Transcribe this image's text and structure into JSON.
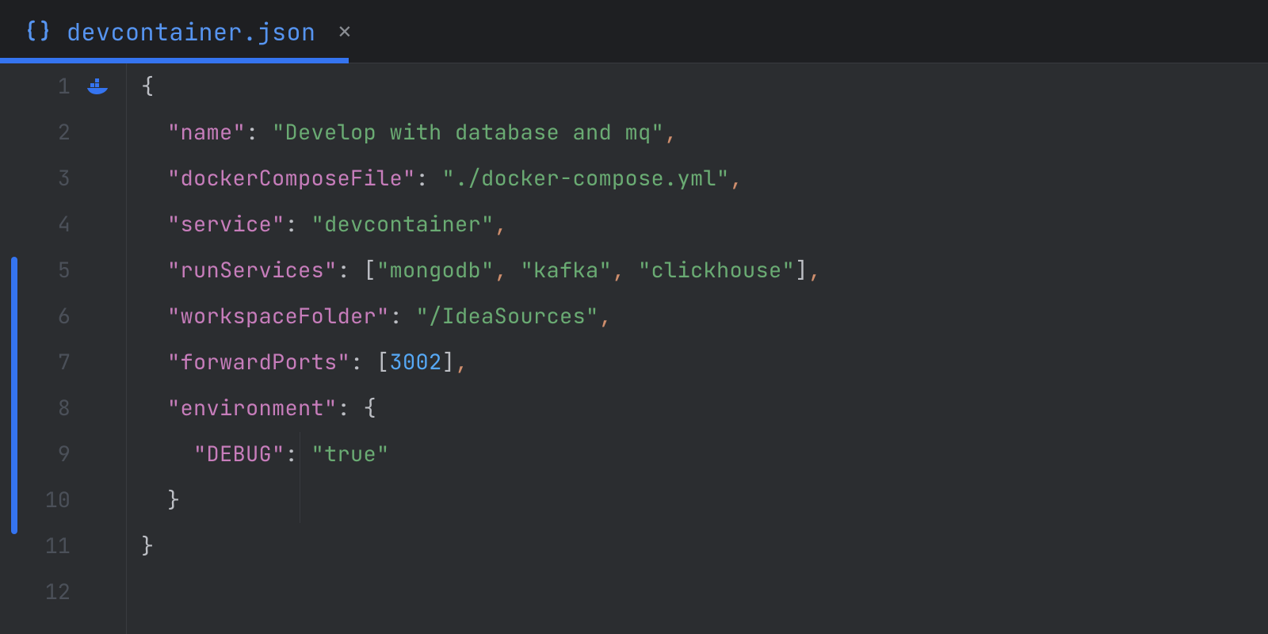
{
  "tab": {
    "title": "devcontainer.json",
    "icon_name": "braces-icon"
  },
  "gutter": {
    "lines": [
      "1",
      "2",
      "3",
      "4",
      "5",
      "6",
      "7",
      "8",
      "9",
      "10",
      "11",
      "12"
    ]
  },
  "code": {
    "l1": "{",
    "l2": {
      "key": "\"name\"",
      "sep": ": ",
      "val": "\"Develop with database and mq\"",
      "end": ","
    },
    "l3": {
      "key": "\"dockerComposeFile\"",
      "sep": ": ",
      "val": "\"./docker-compose.yml\"",
      "end": ","
    },
    "l4": {
      "key": "\"service\"",
      "sep": ": ",
      "val": "\"devcontainer\"",
      "end": ","
    },
    "l5": {
      "key": "\"runServices\"",
      "sep": ": ",
      "lb": "[",
      "v1": "\"mongodb\"",
      "c1": ", ",
      "v2": "\"kafka\"",
      "c2": ", ",
      "v3": "\"clickhouse\"",
      "rb": "]",
      "end": ","
    },
    "l6": {
      "key": "\"workspaceFolder\"",
      "sep": ": ",
      "val": "\"/IdeaSources\"",
      "end": ","
    },
    "l7": {
      "key": "\"forwardPorts\"",
      "sep": ": ",
      "lb": "[",
      "num": "3002",
      "rb": "]",
      "end": ","
    },
    "l8": {
      "key": "\"environment\"",
      "sep": ": ",
      "brace": "{"
    },
    "l9": {
      "key": "\"DEBUG\"",
      "sep": ": ",
      "val": "\"true\""
    },
    "l10": "}",
    "l11": "}",
    "l12": ""
  }
}
